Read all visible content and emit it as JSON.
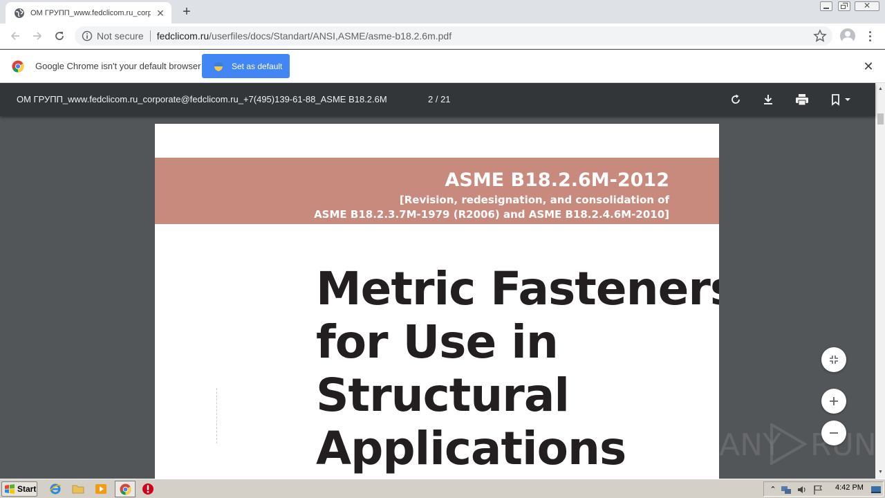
{
  "browser": {
    "tab": {
      "title": "ОМ ГРУПП_www.fedclicom.ru_corporate@fedclicom.ru_+7(495)139-61-88_ASME B18.2.6M"
    },
    "new_tab_label": "+",
    "address": {
      "security_text": "Not secure",
      "host": "fedclicom.ru",
      "path": "/userfiles/docs/Standart/ANSI,ASME/asme-b18.2.6m.pdf"
    }
  },
  "infobar": {
    "message": "Google Chrome isn't your default browser",
    "button_label": "Set as default",
    "close_label": "✕"
  },
  "pdf_viewer": {
    "title": "ОМ ГРУПП_www.fedclicom.ru_corporate@fedclicom.ru_+7(495)139-61-88_ASME B18.2.6M",
    "page_indicator": "2 / 21",
    "tools": [
      "rotate-icon",
      "download-icon",
      "print-icon",
      "bookmark-icon"
    ]
  },
  "document": {
    "standard": "ASME B18.2.6M-2012",
    "revision_line1": "[Revision, redesignation, and consolidation of",
    "revision_line2": "ASME B18.2.3.7M-1979 (R2006) and ASME B18.2.4.6M-2010]",
    "title_lines": [
      "Metric Fasteners",
      "for Use in",
      "Structural",
      "Applications"
    ]
  },
  "watermark": {
    "left": "ANY",
    "right": "RUN"
  },
  "taskbar": {
    "start_label": "Start",
    "clock": "4:42 PM"
  },
  "colors": {
    "band": "#c98a7e",
    "pdf_toolbar": "#323639",
    "viewer_bg": "#525659",
    "accent": "#4285f4"
  }
}
